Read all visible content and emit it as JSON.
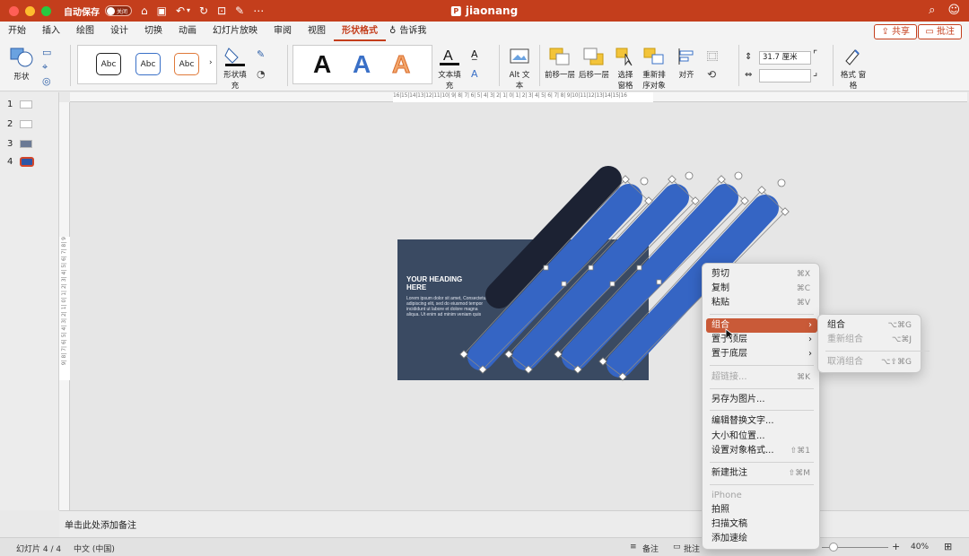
{
  "titlebar": {
    "autosave_label": "自动保存",
    "autosave_state": "关闭",
    "doc_title": "jiaonang",
    "doc_icon": "P"
  },
  "tabs": [
    "开始",
    "插入",
    "绘图",
    "设计",
    "切换",
    "动画",
    "幻灯片放映",
    "审阅",
    "视图",
    "形状格式",
    "告诉我"
  ],
  "active_tab": "形状格式",
  "actions": {
    "share": "共享",
    "comment": "批注"
  },
  "ribbon": {
    "shape_label": "形状",
    "style_sample": "Abc",
    "shape_fill": "形状填充",
    "wordart_sample": "A",
    "text_fill": "文本填充",
    "alt_text": "Alt 文本",
    "bring_forward": "前移一层",
    "send_backward": "后移一层",
    "selection_pane": "选择 窗格",
    "reorder": "重新排 序对象",
    "align": "对齐",
    "height_value": "31.7 厘米",
    "format_pane": "格式 窗格"
  },
  "thumbnails": [
    "1",
    "2",
    "3",
    "4"
  ],
  "selected_slide": "4",
  "rulers": {
    "horizontal": "16|15|14|13|12|11|10| 9| 8| 7| 6| 5| 4| 3| 2| 1| 0| 1| 2| 3| 4| 5| 6| 7| 8| 9|10|11|12|13|14|15|16",
    "vertical": "9| 8| 7| 6| 5| 4| 3| 2| 1| 0| 1| 2| 3| 4| 5| 6| 7| 8| 9"
  },
  "slide": {
    "heading": "YOUR HEADING HERE",
    "body": "Lorem ipsum dolor sit amet, Consectetur adipiscing elit, sed do eiusmod tempor incididunt ut labore et dolore magna aliqua. Ut enim ad minim veniam quis"
  },
  "notes_placeholder": "单击此处添加备注",
  "status": {
    "slide_index": "幻灯片 4 / 4",
    "language": "中文 (中国)",
    "notes": "备注",
    "comments": "批注",
    "zoom": "40%"
  },
  "context_menu": {
    "cut": "剪切",
    "cut_sc": "⌘X",
    "copy": "复制",
    "copy_sc": "⌘C",
    "paste": "粘贴",
    "paste_sc": "⌘V",
    "group": "组合",
    "bring_front": "置于顶层",
    "send_back": "置于底层",
    "hyperlink": "超链接...",
    "hyperlink_sc": "⌘K",
    "save_as_picture": "另存为图片...",
    "edit_alt_text": "编辑替换文字...",
    "size_position": "大小和位置...",
    "format_object": "设置对象格式...",
    "format_object_sc": "⇧⌘1",
    "new_comment": "新建批注",
    "new_comment_sc": "⇧⌘M",
    "iphone_header": "iPhone",
    "take_photo": "拍照",
    "scan_document": "扫描文稿",
    "add_sketch": "添加速绘"
  },
  "submenu": {
    "group": "组合",
    "group_sc": "⌥⌘G",
    "regroup": "重新组合",
    "regroup_sc": "⌥⌘J",
    "ungroup": "取消组合",
    "ungroup_sc": "⌥⇧⌘G"
  },
  "colors": {
    "accent": "#c43e1c",
    "capsule_blue": "#3565c4",
    "capsule_dark": "#1c2233",
    "slide_bg": "#3a4a62",
    "menu_highlight": "#c95a38"
  }
}
